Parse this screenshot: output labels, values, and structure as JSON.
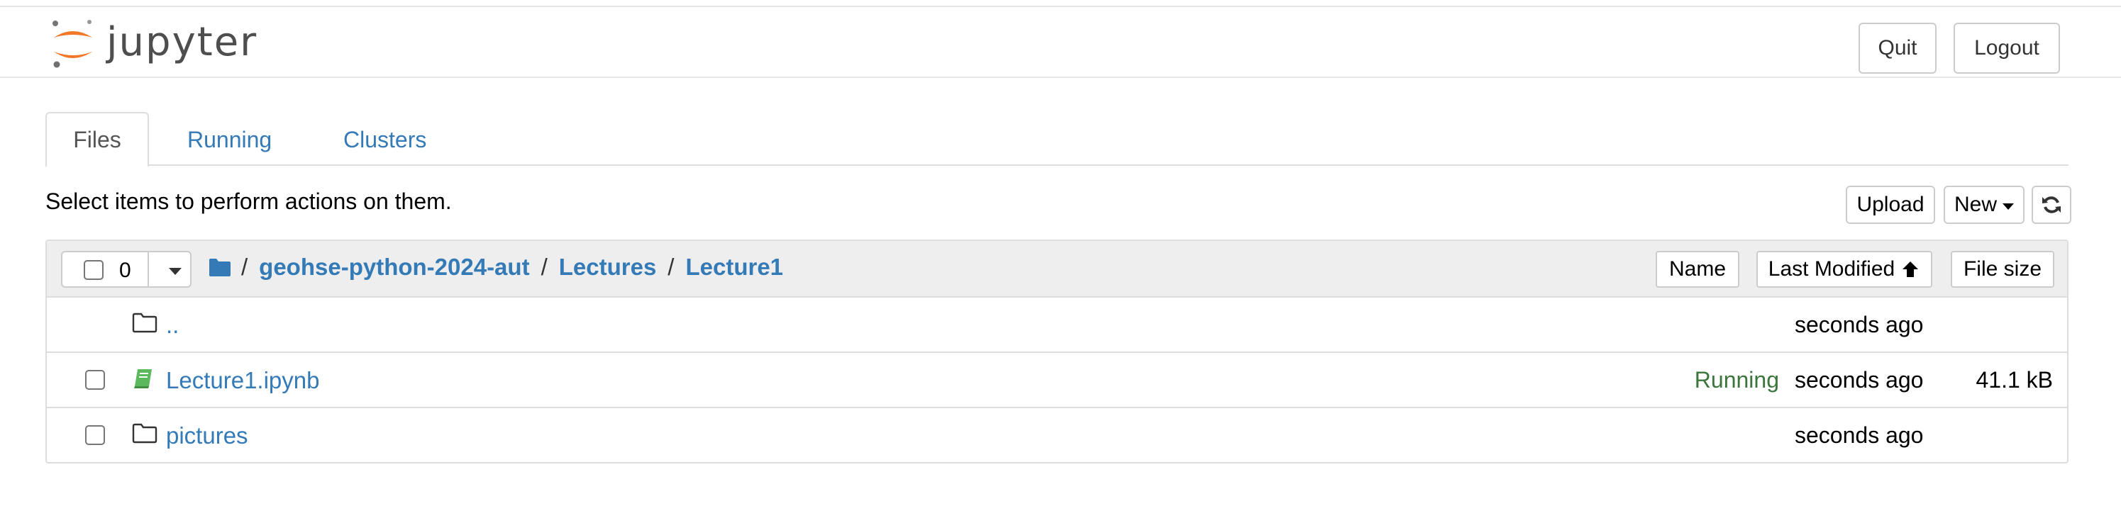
{
  "header": {
    "logo_text": "jupyter",
    "quit_label": "Quit",
    "logout_label": "Logout"
  },
  "tabs": [
    {
      "label": "Files",
      "active": true
    },
    {
      "label": "Running",
      "active": false
    },
    {
      "label": "Clusters",
      "active": false
    }
  ],
  "toolbar": {
    "instructions": "Select items to perform actions on them.",
    "upload_label": "Upload",
    "new_label": "New"
  },
  "list_header": {
    "selected_count": "0",
    "breadcrumb": [
      "geohse-python-2024-aut",
      "Lectures",
      "Lecture1"
    ],
    "separator": "/",
    "sort_name_label": "Name",
    "sort_modified_label": "Last Modified",
    "sort_size_label": "File size"
  },
  "rows": [
    {
      "name": "..",
      "type": "folder",
      "status": "",
      "modified": "seconds ago",
      "size": ""
    },
    {
      "name": "Lecture1.ipynb",
      "type": "notebook",
      "status": "Running",
      "modified": "seconds ago",
      "size": "41.1 kB"
    },
    {
      "name": "pictures",
      "type": "folder",
      "status": "",
      "modified": "seconds ago",
      "size": ""
    }
  ],
  "colors": {
    "link": "#337ab7",
    "running": "#3c763d",
    "logo_orange": "#f37726",
    "notebook_icon": "#5cb85c"
  },
  "icons": {
    "logo": "jupyter-logo-icon",
    "folder_header": "folder-solid-icon",
    "folder": "folder-outline-icon",
    "notebook": "notebook-icon",
    "refresh": "refresh-icon",
    "sort": "arrow-up-icon"
  }
}
